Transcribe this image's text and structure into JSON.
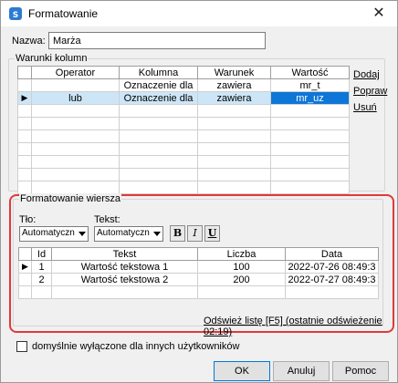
{
  "window": {
    "title": "Formatowanie",
    "close_glyph": "✕"
  },
  "name_field": {
    "label": "Nazwa:",
    "value": "Marża"
  },
  "column_conditions": {
    "group_title": "Warunki kolumn",
    "headers": [
      "Operator",
      "Kolumna",
      "Warunek",
      "Wartość"
    ],
    "rows": [
      {
        "indicator": "",
        "operator": "",
        "column": "Oznaczenie dla",
        "condition": "zawiera",
        "value": "mr_t",
        "selected": false
      },
      {
        "indicator": "▶",
        "operator": "lub",
        "column": "Oznaczenie dla",
        "condition": "zawiera",
        "value": "mr_uz",
        "selected": true
      }
    ],
    "links": {
      "add": "Dodaj",
      "edit": "Popraw",
      "delete": "Usuń"
    }
  },
  "row_formatting": {
    "group_title": "Formatowanie wiersza",
    "background": {
      "label": "Tło:",
      "value": "Automatyczn"
    },
    "text": {
      "label": "Tekst:",
      "value": "Automatyczn"
    },
    "format_buttons": {
      "bold": "B",
      "italic": "I",
      "underline": "U"
    },
    "preview": {
      "headers": [
        "Id",
        "Tekst",
        "Liczba",
        "Data"
      ],
      "rows": [
        {
          "indicator": "▶",
          "id": "1",
          "text": "Wartość tekstowa 1",
          "number": "100",
          "date": "2022-07-26 08:49:3"
        },
        {
          "indicator": "",
          "id": "2",
          "text": "Wartość tekstowa 2",
          "number": "200",
          "date": "2022-07-27 08:49:3"
        }
      ]
    },
    "refresh_link": "Odśwież listę [F5] (ostatnie odświeżenie 02:19)"
  },
  "default_disabled": {
    "label": "domyślnie wyłączone dla innych użytkowników",
    "checked": false
  },
  "buttons": {
    "ok": "OK",
    "cancel": "Anuluj",
    "help": "Pomoc"
  },
  "colors": {
    "highlight": "#e0393b",
    "selection": "#0e76d6",
    "selected_row": "#cde6f7"
  }
}
